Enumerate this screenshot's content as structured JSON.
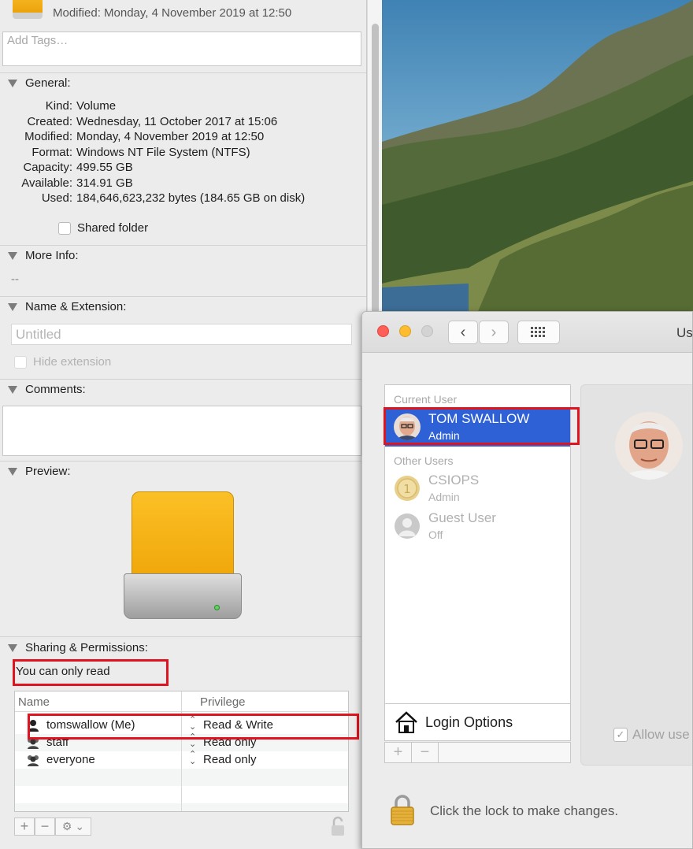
{
  "info_panel": {
    "modified_header": "Modified: Monday, 4 November 2019 at 12:50",
    "tags_placeholder": "Add Tags…",
    "general": {
      "title": "General:",
      "rows": [
        {
          "key": "Kind:",
          "value": "Volume"
        },
        {
          "key": "Created:",
          "value": "Wednesday, 11 October 2017 at 15:06"
        },
        {
          "key": "Modified:",
          "value": "Monday, 4 November 2019 at 12:50"
        },
        {
          "key": "Format:",
          "value": "Windows NT File System (NTFS)"
        },
        {
          "key": "Capacity:",
          "value": "499.55 GB"
        },
        {
          "key": "Available:",
          "value": "314.91 GB"
        },
        {
          "key": "Used:",
          "value": "184,646,623,232 bytes (184.65 GB on disk)"
        }
      ],
      "shared_folder_label": "Shared folder",
      "shared_folder_checked": false
    },
    "more_info": {
      "title": "More Info:",
      "value": "--"
    },
    "name_extension": {
      "title": "Name & Extension:",
      "name_placeholder": "Untitled",
      "hide_extension_label": "Hide extension"
    },
    "comments": {
      "title": "Comments:"
    },
    "preview": {
      "title": "Preview:"
    },
    "sharing": {
      "title": "Sharing & Permissions:",
      "status": "You can only read",
      "columns": {
        "name": "Name",
        "privilege": "Privilege"
      },
      "rows": [
        {
          "name": "tomswallow (Me)",
          "privilege": "Read & Write",
          "icon": "single-user-icon"
        },
        {
          "name": "staff",
          "privilege": "Read only",
          "icon": "group-icon"
        },
        {
          "name": "everyone",
          "privilege": "Read only",
          "icon": "group-icon"
        }
      ],
      "buttons": {
        "add": "+",
        "remove": "−"
      }
    }
  },
  "users_window": {
    "title": "Us",
    "current_user_label": "Current User",
    "other_users_label": "Other Users",
    "current_user": {
      "name": "TOM SWALLOW",
      "role": "Admin"
    },
    "other_users": [
      {
        "name": "CSIOPS",
        "role": "Admin"
      },
      {
        "name": "Guest User",
        "role": "Off"
      }
    ],
    "login_options_label": "Login Options",
    "buttons": {
      "add": "+",
      "remove": "−"
    },
    "allow_label": "Allow use",
    "lock_text": "Click the lock to make changes."
  },
  "colors": {
    "selection": "#2e60d6",
    "highlight_box": "#e0141e",
    "drive_orange": "#f5b119"
  }
}
